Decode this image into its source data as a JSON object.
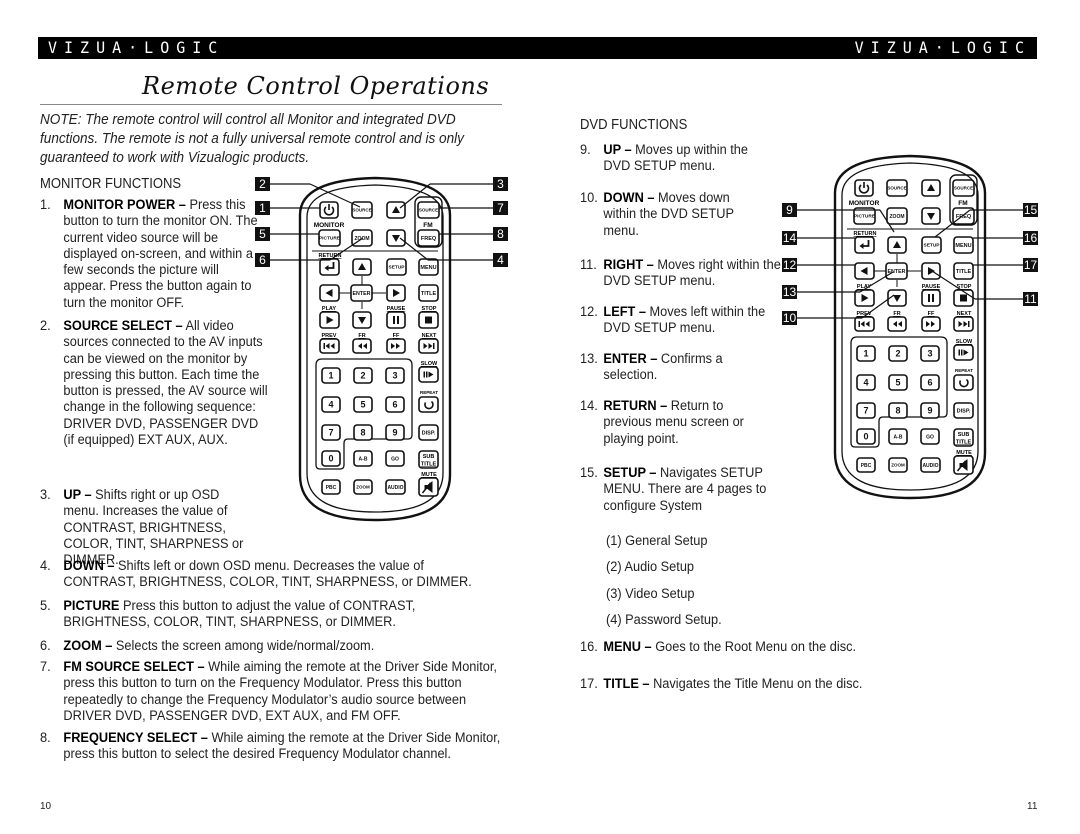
{
  "brand": "VIZUA·LOGIC",
  "left_page": {
    "title": "Remote Control Operations",
    "note": "NOTE: The remote control will control all Monitor and integrated DVD functions. The remote is not a fully universal remote control and is only guaranteed to work with Vizualogic products.",
    "section_heading": "MONITOR FUNCTIONS",
    "items": [
      {
        "num": "1.",
        "label": "MONITOR POWER –",
        "text": " Press this button to turn the monitor ON. The current video source will be displayed on-screen, and within a few seconds the picture will appear. Press the button again to turn the monitor OFF."
      },
      {
        "num": "2.",
        "label": "SOURCE SELECT –",
        "text": " All video sources connected to the AV inputs can be viewed on the monitor by pressing this button. Each time the button is pressed, the AV source will change in the following sequence: DRIVER DVD, PASSENGER DVD (if equipped) EXT AUX, AUX."
      },
      {
        "num": "3.",
        "label": "UP –",
        "text": " Shifts right or up OSD menu. Increases the value of CONTRAST, BRIGHTNESS, COLOR, TINT, SHARPNESS or DIMMER."
      },
      {
        "num": "4.",
        "label": "DOWN –",
        "text": " Shifts left or down OSD menu. Decreases the value of CONTRAST, BRIGHTNESS, COLOR, TINT, SHARPNESS, or DIMMER."
      },
      {
        "num": "5.",
        "label": "PICTURE",
        "text": " Press this button to adjust the value  of CONTRAST, BRIGHTNESS, COLOR, TINT, SHARPNESS, or DIMMER."
      },
      {
        "num": "6.",
        "label": "ZOOM –",
        "text": " Selects the screen among wide/normal/zoom."
      },
      {
        "num": "7.",
        "label": "FM SOURCE SELECT –",
        "text": " While aiming the remote at the Driver Side Monitor, press this button to turn on the Frequency Modulator. Press this button repeatedly to change the Frequency Modulator’s audio source between DRIVER DVD, PASSENGER DVD, EXT AUX, and FM OFF."
      },
      {
        "num": "8.",
        "label": "FREQUENCY SELECT –",
        "text": " While aiming the remote at the Driver Side Monitor, press this button to select the desired Frequency Modulator channel."
      }
    ],
    "callouts": [
      "2",
      "1",
      "5",
      "6",
      "3",
      "7",
      "8",
      "4"
    ],
    "page_number": "10"
  },
  "right_page": {
    "section_heading": "DVD FUNCTIONS",
    "items": [
      {
        "num": "9.",
        "label": "UP –",
        "text": " Moves up within the DVD SETUP menu."
      },
      {
        "num": "10.",
        "label": "DOWN –",
        "text": " Moves down within the DVD SETUP menu."
      },
      {
        "num": "11.",
        "label": "RIGHT –",
        "text": " Moves right within the DVD SETUP menu."
      },
      {
        "num": "12.",
        "label": "LEFT –",
        "text": " Moves left within the DVD SETUP menu."
      },
      {
        "num": "13.",
        "label": "ENTER –",
        "text": " Confirms a selection."
      },
      {
        "num": "14.",
        "label": "RETURN –",
        "text": " Return to previous menu screen or playing point."
      },
      {
        "num": "15.",
        "label": "SETUP –",
        "text": " Navigates SETUP MENU. There are 4 pages to configure System"
      },
      {
        "num": "16.",
        "label": "MENU –",
        "text": " Goes to the Root Menu on the disc."
      },
      {
        "num": "17.",
        "label": "TITLE –",
        "text": " Navigates the Title Menu on the disc."
      }
    ],
    "setup_pages": [
      "(1) General Setup",
      "(2) Audio Setup",
      "(3) Video Setup",
      "(4) Password Setup."
    ],
    "callouts": [
      "9",
      "14",
      "12",
      "13",
      "10",
      "15",
      "16",
      "17",
      "11"
    ],
    "page_number": "11"
  },
  "remote": {
    "labels": {
      "source": "SOURCE",
      "monitor": "MONITOR",
      "fm": "FM",
      "picture": "PICTURE",
      "zoom": "ZOOM",
      "freq": "FREQ",
      "return": "RETURN",
      "setup": "SETUP",
      "menu": "MENU",
      "enter": "ENTER",
      "title": "TITLE",
      "play": "PLAY",
      "pause": "PAUSE",
      "stop": "STOP",
      "prev": "PREV",
      "fr": "FR",
      "ff": "FF",
      "next": "NEXT",
      "slow": "SLOW",
      "repeat": "REPEAT",
      "disp": "DISP.",
      "sub": "SUB",
      "title2": "TITLE",
      "mute": "MUTE",
      "ab": "A-B",
      "go": "GO",
      "pbc": "PBC",
      "audio": "AUDIO",
      "digits": [
        "1",
        "2",
        "3",
        "4",
        "5",
        "6",
        "7",
        "8",
        "9",
        "0"
      ]
    }
  }
}
